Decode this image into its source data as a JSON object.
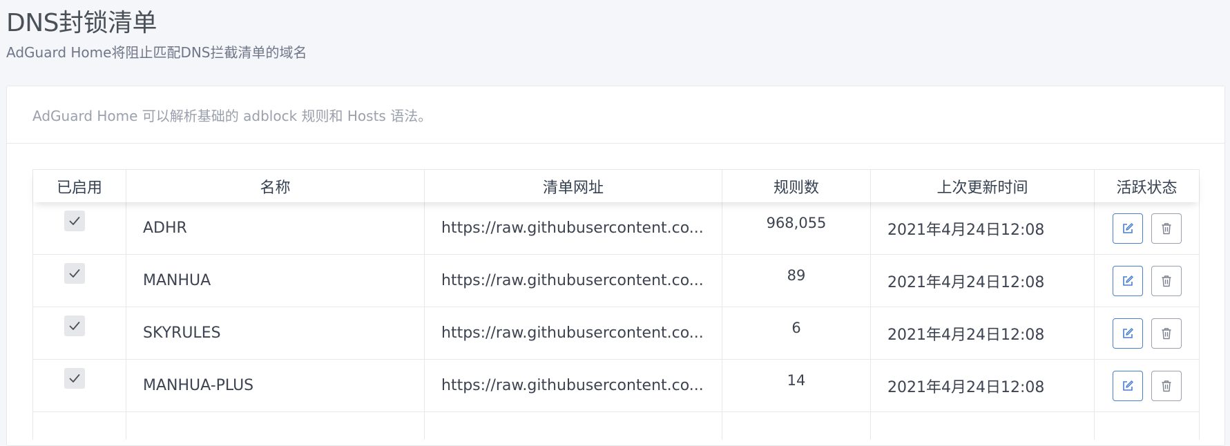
{
  "page": {
    "title": "DNS封锁清单",
    "subtitle": "AdGuard Home将阻止匹配DNS拦截清单的域名"
  },
  "card": {
    "description": "AdGuard Home 可以解析基础的 adblock 规则和 Hosts 语法。"
  },
  "table": {
    "columns": [
      "已启用",
      "名称",
      "清单网址",
      "规则数",
      "上次更新时间",
      "活跃状态"
    ],
    "rows": [
      {
        "enabled": true,
        "name": "ADHR",
        "url": "https://raw.githubusercontent.co...",
        "rules": "968,055",
        "updated": "2021年4月24日12:08"
      },
      {
        "enabled": true,
        "name": "MANHUA",
        "url": "https://raw.githubusercontent.co...",
        "rules": "89",
        "updated": "2021年4月24日12:08"
      },
      {
        "enabled": true,
        "name": "SKYRULES",
        "url": "https://raw.githubusercontent.co...",
        "rules": "6",
        "updated": "2021年4月24日12:08"
      },
      {
        "enabled": true,
        "name": "MANHUA-PLUS",
        "url": "https://raw.githubusercontent.co...",
        "rules": "14",
        "updated": "2021年4月24日12:08"
      }
    ]
  },
  "icons": {
    "checkbox": "check-icon",
    "edit": "edit-icon",
    "delete": "trash-icon"
  },
  "colors": {
    "background": "#f4f6fa",
    "edit_accent": "#467fcf",
    "muted": "#9aa0ac"
  }
}
